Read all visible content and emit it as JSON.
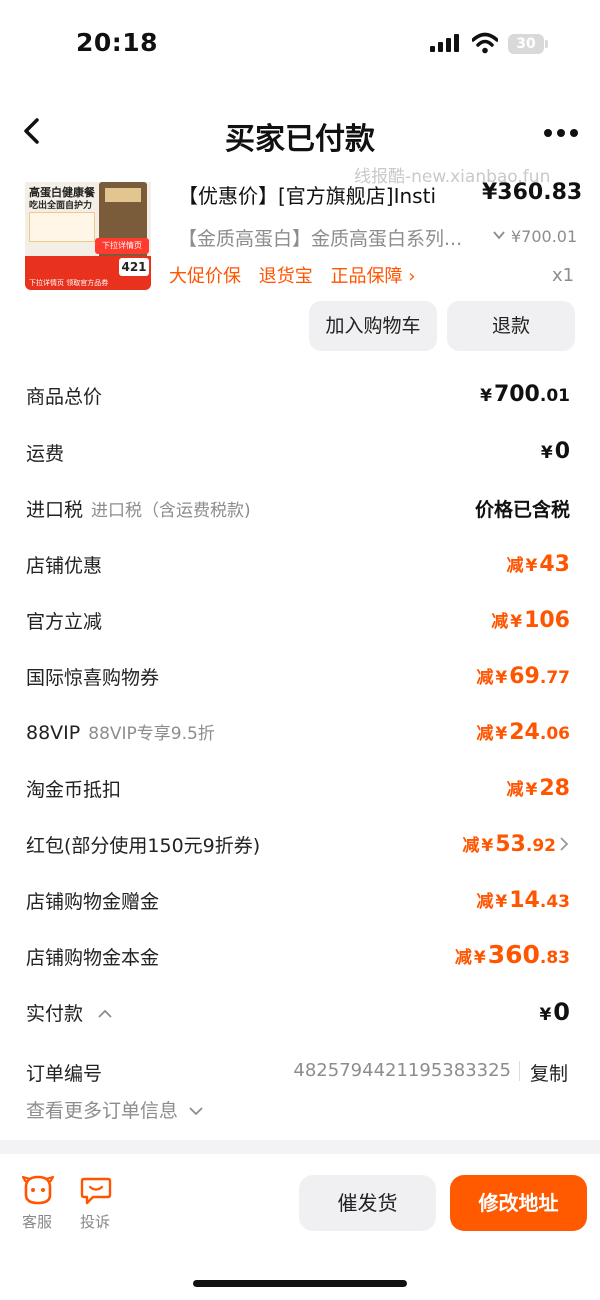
{
  "status_bar": {
    "time": "20:18",
    "battery": "30"
  },
  "nav": {
    "title": "买家已付款"
  },
  "watermark": "线报酷-new.xianbao.fun",
  "product": {
    "name": "【优惠价】[官方旗舰店]Insti",
    "price": "¥360.83",
    "spec": "【金质高蛋白】金质高蛋白系列...",
    "original_price": "¥700.01",
    "tags": [
      "大促价保",
      "退货宝",
      "正品保障 ›"
    ],
    "quantity": "x1",
    "thumb_text": {
      "headline1": "高蛋白健康餐",
      "headline2": "吃出全面自护力",
      "coupon": "下拉详情页",
      "price": "421",
      "bottom": "下拉详情页 领取官方品券"
    }
  },
  "actions": {
    "add_to_cart": "加入购物车",
    "refund": "退款"
  },
  "summary": [
    {
      "label": "商品总价",
      "sub": "",
      "prefix": "",
      "cur": "¥",
      "int": "700",
      "dec": ".01",
      "color": "black"
    },
    {
      "label": "运费",
      "sub": "",
      "prefix": "",
      "cur": "¥",
      "int": "0",
      "dec": "",
      "color": "black"
    },
    {
      "label": "店铺优惠",
      "sub": "",
      "prefix": "减",
      "cur": "¥",
      "int": "43",
      "dec": "",
      "color": "orange"
    },
    {
      "label": "官方立减",
      "sub": "",
      "prefix": "减",
      "cur": "¥",
      "int": "106",
      "dec": "",
      "color": "orange"
    },
    {
      "label": "国际惊喜购物券",
      "sub": "",
      "prefix": "减",
      "cur": "¥",
      "int": "69",
      "dec": ".77",
      "color": "orange"
    },
    {
      "label": "88VIP",
      "sub": "88VIP专享9.5折",
      "prefix": "减",
      "cur": "¥",
      "int": "24",
      "dec": ".06",
      "color": "orange"
    },
    {
      "label": "淘金币抵扣",
      "sub": "",
      "prefix": "减",
      "cur": "¥",
      "int": "28",
      "dec": "",
      "color": "orange"
    },
    {
      "label": "红包(部分使用150元9折券)",
      "sub": "",
      "prefix": "减",
      "cur": "¥",
      "int": "53",
      "dec": ".92",
      "color": "orange"
    },
    {
      "label": "店铺购物金赠金",
      "sub": "",
      "prefix": "减",
      "cur": "¥",
      "int": "14",
      "dec": ".43",
      "color": "orange"
    },
    {
      "label": "店铺购物金本金",
      "sub": "",
      "prefix": "减",
      "cur": "¥",
      "int": "360",
      "dec": ".83",
      "color": "orange"
    },
    {
      "label": "实付款",
      "sub": "",
      "prefix": "",
      "cur": "¥",
      "int": "0",
      "dec": "",
      "color": "black"
    }
  ],
  "import_tax": {
    "label": "进口税",
    "sub": "进口税（含运费税款)",
    "value": "价格已含税"
  },
  "order": {
    "label": "订单编号",
    "number": "4825794421195383325",
    "copy": "复制",
    "more": "查看更多订单信息"
  },
  "bottom_bar": {
    "service": "客服",
    "complain": "投诉",
    "urge": "催发货",
    "modify_address": "修改地址"
  },
  "colors": {
    "accent": "#ff5500",
    "button_primary": "#ff5a00",
    "muted": "#8d8d8d"
  }
}
